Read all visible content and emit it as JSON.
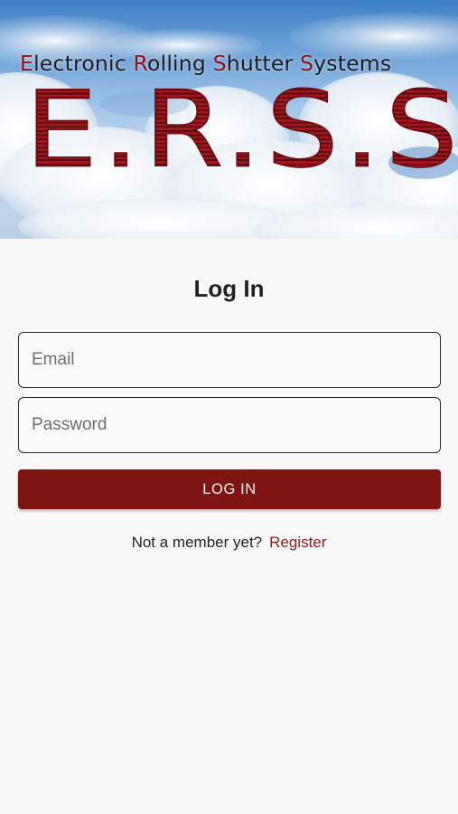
{
  "banner": {
    "tagline": {
      "w1_cap": "E",
      "w1_rest": "lectronic ",
      "w2_cap": "R",
      "w2_rest": "olling ",
      "w3_cap": "S",
      "w3_rest": "hutter ",
      "w4_cap": "S",
      "w4_rest": "ystems"
    },
    "logo": "E.R.S.S."
  },
  "login": {
    "title": "Log In",
    "email_placeholder": "Email",
    "password_placeholder": "Password",
    "submit_label": "LOG IN",
    "register_prompt": "Not a member yet?",
    "register_link": "Register"
  },
  "colors": {
    "accent": "#7f1411",
    "link": "#8d1c18",
    "logo_red": "#a3161c"
  }
}
